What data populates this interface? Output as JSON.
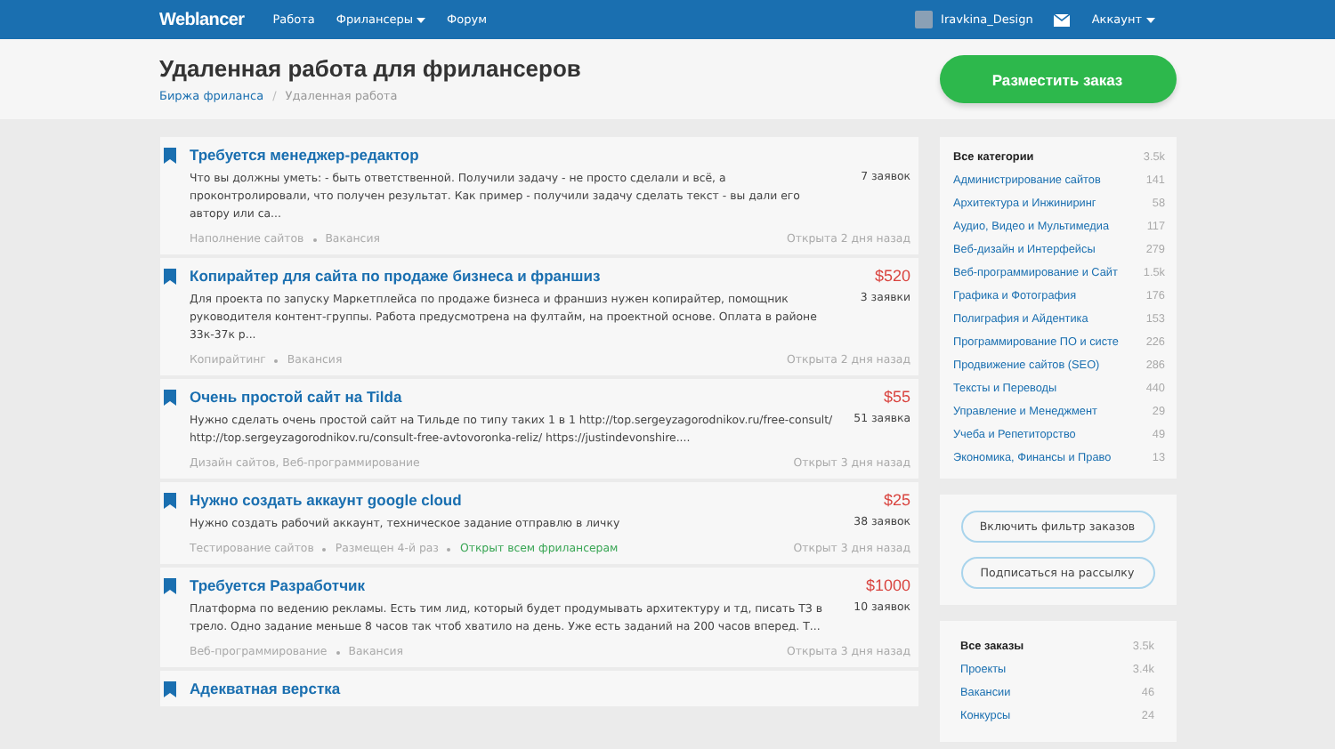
{
  "nav": {
    "logo": "Weblancer",
    "links": [
      {
        "label": "Работа",
        "dropdown": false
      },
      {
        "label": "Фрилансеры",
        "dropdown": true
      },
      {
        "label": "Форум",
        "dropdown": false
      }
    ],
    "user": {
      "name": "Iravkina_Design"
    },
    "account": {
      "label": "Аккаунт",
      "dropdown": true
    }
  },
  "header": {
    "title": "Удаленная работа для фрилансеров",
    "breadcrumbs": [
      {
        "label": "Биржа фриланса",
        "link": true
      },
      {
        "label": "Удаленная работа",
        "link": false
      }
    ],
    "button": "Разместить заказ",
    "breadcrumb_separator": "/"
  },
  "jobs": [
    {
      "title": "Требуется менеджер-редактор",
      "description": "Что вы должны уметь: - быть ответственной. Получили задачу - не просто сделали и всё, а проконтролировали, что получен результат. Как пример - получили задачу сделать текст - вы дали его автору или са...",
      "bids": "7 заявок",
      "tags": [
        {
          "text": "Наполнение сайтов",
          "kind": "plain"
        },
        {
          "text": "Вакансия",
          "kind": "plain"
        }
      ],
      "posted": "Открыта 2 дня назад"
    },
    {
      "title": "Копирайтер для сайта по продаже бизнеса и франшиз",
      "price": "$520",
      "description": "Для проекта по запуску Маркетплейса по продаже бизнеса и франшиз нужен копирайтер, помощник руководителя контент-группы. Работа предусмотрена на фултайм, на проектной основе. Оплата в районе 33к-37к р...",
      "bids": "3 заявки",
      "tags": [
        {
          "text": "Копирайтинг",
          "kind": "plain"
        },
        {
          "text": "Вакансия",
          "kind": "plain"
        }
      ],
      "posted": "Открыта 2 дня назад"
    },
    {
      "title": "Очень простой сайт на Tilda",
      "price": "$55",
      "description": "Нужно сделать очень простой сайт на Тильде по типу таких 1 в 1 http://top.sergeyzagorodnikov.ru/free-consult/ http://top.sergeyzagorodnikov.ru/consult-free-avtovoronka-reliz/ https://justindevonshire....",
      "bids": "51 заявка",
      "tags": [
        {
          "text": "Дизайн сайтов, Веб-программирование",
          "kind": "plain"
        }
      ],
      "posted": "Открыт 3 дня назад"
    },
    {
      "title": "Нужно создать аккаунт google cloud",
      "price": "$25",
      "description": "Нужно создать рабочий аккаунт, техническое задание отправлю в личку",
      "bids": "38 заявок",
      "tags": [
        {
          "text": "Тестирование сайтов",
          "kind": "plain"
        },
        {
          "text": "Размещен 4-й раз",
          "kind": "plain"
        },
        {
          "text": "Открыт всем фрилансерам",
          "kind": "open"
        }
      ],
      "posted": "Открыт 3 дня назад"
    },
    {
      "title": "Требуется Разработчик",
      "price": "$1000",
      "description": "Платформа по ведению рекламы. Есть тим лид, который будет продумывать архитектуру и тд, писать ТЗ в трело. Одно задание меньше 8 часов так чтоб хватило на день. Уже есть заданий на 200 часов вперед. Т...",
      "bids": "10 заявок",
      "tags": [
        {
          "text": "Веб-программирование",
          "kind": "plain"
        },
        {
          "text": "Вакансия",
          "kind": "plain"
        }
      ],
      "posted": "Открыта 3 дня назад"
    },
    {
      "title": "Адекватная верстка"
    }
  ],
  "sidebar": {
    "categories": [
      {
        "label": "Все категории",
        "count": "3.5k",
        "kind": "all"
      },
      {
        "label": "Администрирование сайтов",
        "count": "141",
        "kind": "link"
      },
      {
        "label": "Архитектура и Инжиниринг",
        "count": "58",
        "kind": "link"
      },
      {
        "label": "Аудио, Видео и Мультимедиа",
        "count": "117",
        "kind": "link"
      },
      {
        "label": "Веб-дизайн и Интерфейсы",
        "count": "279",
        "kind": "link"
      },
      {
        "label": "Веб-программирование и Сайт",
        "count": "1.5k",
        "kind": "link"
      },
      {
        "label": "Графика и Фотография",
        "count": "176",
        "kind": "link"
      },
      {
        "label": "Полиграфия и Айдентика",
        "count": "153",
        "kind": "link"
      },
      {
        "label": "Программирование ПО и систе",
        "count": "226",
        "kind": "link"
      },
      {
        "label": "Продвижение сайтов (SEO)",
        "count": "286",
        "kind": "link"
      },
      {
        "label": "Тексты и Переводы",
        "count": "440",
        "kind": "link"
      },
      {
        "label": "Управление и Менеджмент",
        "count": "29",
        "kind": "link"
      },
      {
        "label": "Учеба и Репетиторство",
        "count": "49",
        "kind": "link"
      },
      {
        "label": "Экономика, Финансы и Право",
        "count": "13",
        "kind": "link"
      }
    ],
    "actions": [
      "Включить фильтр заказов",
      "Подписаться на рассылку"
    ],
    "orders": [
      {
        "label": "Все заказы",
        "count": "3.5k",
        "kind": "all"
      },
      {
        "label": "Проекты",
        "count": "3.4k",
        "kind": "link"
      },
      {
        "label": "Вакансии",
        "count": "46",
        "kind": "link"
      },
      {
        "label": "Конкурсы",
        "count": "24",
        "kind": "link"
      }
    ]
  }
}
